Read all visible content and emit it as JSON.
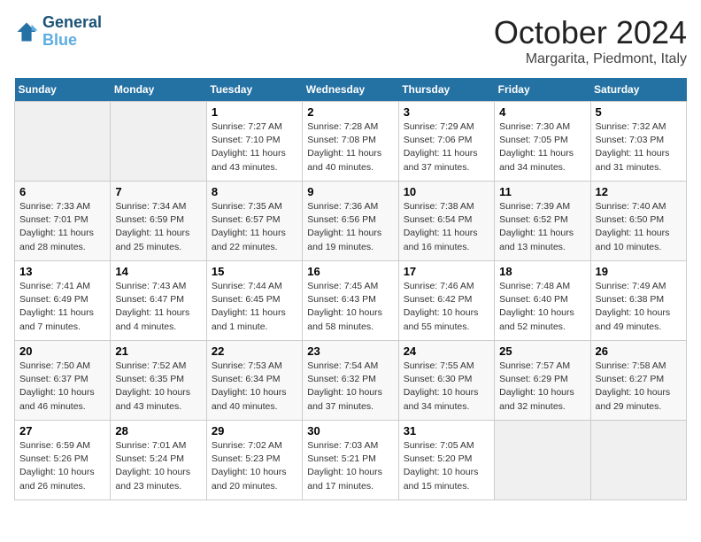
{
  "header": {
    "logo_line1": "General",
    "logo_line2": "Blue",
    "month": "October 2024",
    "location": "Margarita, Piedmont, Italy"
  },
  "weekdays": [
    "Sunday",
    "Monday",
    "Tuesday",
    "Wednesday",
    "Thursday",
    "Friday",
    "Saturday"
  ],
  "weeks": [
    [
      {
        "day": "",
        "empty": true
      },
      {
        "day": "",
        "empty": true
      },
      {
        "day": "1",
        "sunrise": "7:27 AM",
        "sunset": "7:10 PM",
        "daylight": "11 hours and 43 minutes."
      },
      {
        "day": "2",
        "sunrise": "7:28 AM",
        "sunset": "7:08 PM",
        "daylight": "11 hours and 40 minutes."
      },
      {
        "day": "3",
        "sunrise": "7:29 AM",
        "sunset": "7:06 PM",
        "daylight": "11 hours and 37 minutes."
      },
      {
        "day": "4",
        "sunrise": "7:30 AM",
        "sunset": "7:05 PM",
        "daylight": "11 hours and 34 minutes."
      },
      {
        "day": "5",
        "sunrise": "7:32 AM",
        "sunset": "7:03 PM",
        "daylight": "11 hours and 31 minutes."
      }
    ],
    [
      {
        "day": "6",
        "sunrise": "7:33 AM",
        "sunset": "7:01 PM",
        "daylight": "11 hours and 28 minutes."
      },
      {
        "day": "7",
        "sunrise": "7:34 AM",
        "sunset": "6:59 PM",
        "daylight": "11 hours and 25 minutes."
      },
      {
        "day": "8",
        "sunrise": "7:35 AM",
        "sunset": "6:57 PM",
        "daylight": "11 hours and 22 minutes."
      },
      {
        "day": "9",
        "sunrise": "7:36 AM",
        "sunset": "6:56 PM",
        "daylight": "11 hours and 19 minutes."
      },
      {
        "day": "10",
        "sunrise": "7:38 AM",
        "sunset": "6:54 PM",
        "daylight": "11 hours and 16 minutes."
      },
      {
        "day": "11",
        "sunrise": "7:39 AM",
        "sunset": "6:52 PM",
        "daylight": "11 hours and 13 minutes."
      },
      {
        "day": "12",
        "sunrise": "7:40 AM",
        "sunset": "6:50 PM",
        "daylight": "11 hours and 10 minutes."
      }
    ],
    [
      {
        "day": "13",
        "sunrise": "7:41 AM",
        "sunset": "6:49 PM",
        "daylight": "11 hours and 7 minutes."
      },
      {
        "day": "14",
        "sunrise": "7:43 AM",
        "sunset": "6:47 PM",
        "daylight": "11 hours and 4 minutes."
      },
      {
        "day": "15",
        "sunrise": "7:44 AM",
        "sunset": "6:45 PM",
        "daylight": "11 hours and 1 minute."
      },
      {
        "day": "16",
        "sunrise": "7:45 AM",
        "sunset": "6:43 PM",
        "daylight": "10 hours and 58 minutes."
      },
      {
        "day": "17",
        "sunrise": "7:46 AM",
        "sunset": "6:42 PM",
        "daylight": "10 hours and 55 minutes."
      },
      {
        "day": "18",
        "sunrise": "7:48 AM",
        "sunset": "6:40 PM",
        "daylight": "10 hours and 52 minutes."
      },
      {
        "day": "19",
        "sunrise": "7:49 AM",
        "sunset": "6:38 PM",
        "daylight": "10 hours and 49 minutes."
      }
    ],
    [
      {
        "day": "20",
        "sunrise": "7:50 AM",
        "sunset": "6:37 PM",
        "daylight": "10 hours and 46 minutes."
      },
      {
        "day": "21",
        "sunrise": "7:52 AM",
        "sunset": "6:35 PM",
        "daylight": "10 hours and 43 minutes."
      },
      {
        "day": "22",
        "sunrise": "7:53 AM",
        "sunset": "6:34 PM",
        "daylight": "10 hours and 40 minutes."
      },
      {
        "day": "23",
        "sunrise": "7:54 AM",
        "sunset": "6:32 PM",
        "daylight": "10 hours and 37 minutes."
      },
      {
        "day": "24",
        "sunrise": "7:55 AM",
        "sunset": "6:30 PM",
        "daylight": "10 hours and 34 minutes."
      },
      {
        "day": "25",
        "sunrise": "7:57 AM",
        "sunset": "6:29 PM",
        "daylight": "10 hours and 32 minutes."
      },
      {
        "day": "26",
        "sunrise": "7:58 AM",
        "sunset": "6:27 PM",
        "daylight": "10 hours and 29 minutes."
      }
    ],
    [
      {
        "day": "27",
        "sunrise": "6:59 AM",
        "sunset": "5:26 PM",
        "daylight": "10 hours and 26 minutes."
      },
      {
        "day": "28",
        "sunrise": "7:01 AM",
        "sunset": "5:24 PM",
        "daylight": "10 hours and 23 minutes."
      },
      {
        "day": "29",
        "sunrise": "7:02 AM",
        "sunset": "5:23 PM",
        "daylight": "10 hours and 20 minutes."
      },
      {
        "day": "30",
        "sunrise": "7:03 AM",
        "sunset": "5:21 PM",
        "daylight": "10 hours and 17 minutes."
      },
      {
        "day": "31",
        "sunrise": "7:05 AM",
        "sunset": "5:20 PM",
        "daylight": "10 hours and 15 minutes."
      },
      {
        "day": "",
        "empty": true
      },
      {
        "day": "",
        "empty": true
      }
    ]
  ]
}
